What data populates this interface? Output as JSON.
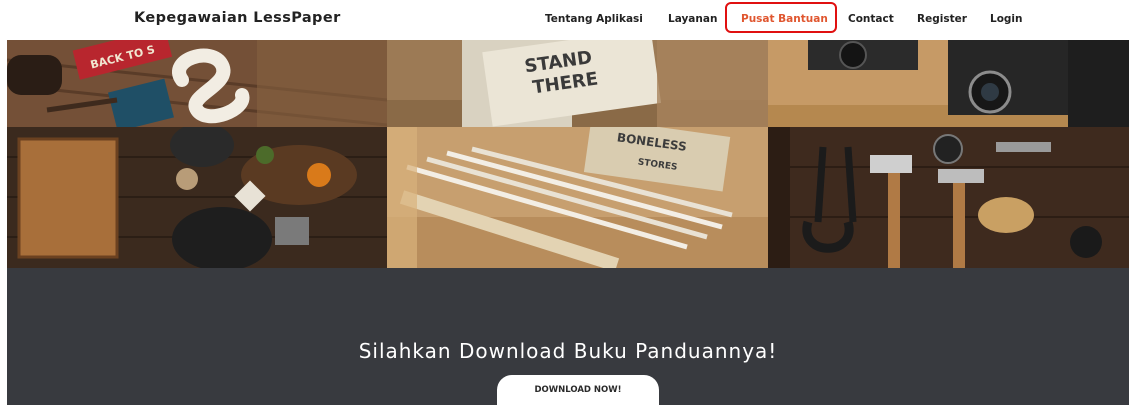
{
  "navbar": {
    "brand": "Kepegawaian LessPaper",
    "items": [
      {
        "label": "Tentang Aplikasi"
      },
      {
        "label": "Layanan"
      },
      {
        "label": "Pusat Bantuan",
        "active": true
      },
      {
        "label": "Contact"
      },
      {
        "label": "Register"
      },
      {
        "label": "Login"
      }
    ]
  },
  "gallery": {
    "tile_texts": {
      "back_to": "BACK TO S",
      "stand": "STAND",
      "there": "THERE",
      "boneless": "BONELESS",
      "stores": "STORES"
    }
  },
  "hero": {
    "title": "Silahkan Download Buku Panduannya!",
    "button_label": "DOWNLOAD NOW!"
  },
  "colors": {
    "active_nav": "#e0562f",
    "highlight_box": "#e01010",
    "hero_bg": "#383a3f"
  }
}
